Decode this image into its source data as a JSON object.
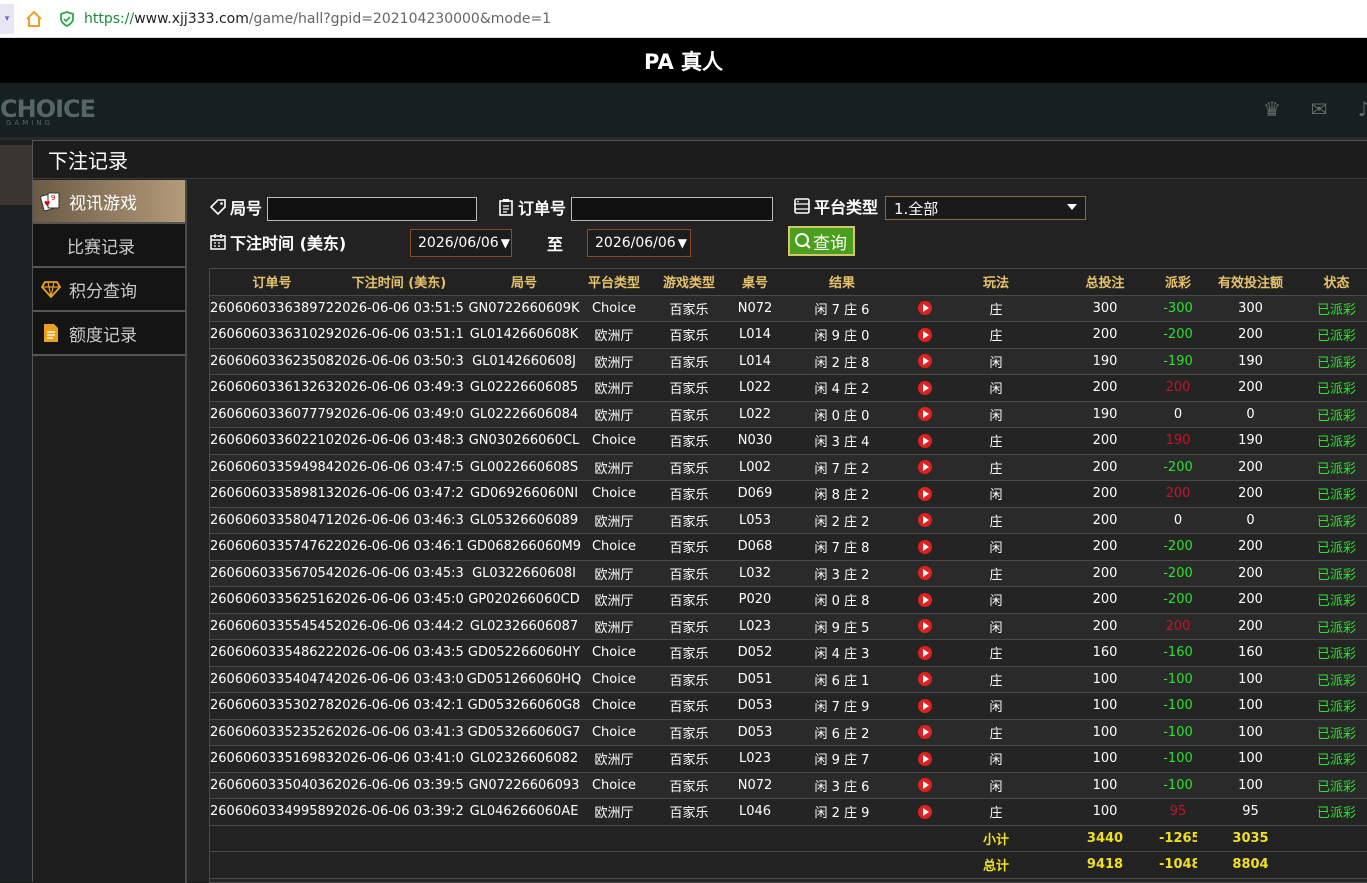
{
  "browser": {
    "url_proto": "https://",
    "url_host": "www.xjj333.com",
    "url_path": "/game/hall?gpid=202104230000&mode=1"
  },
  "title": "PA 真人",
  "lobby": {
    "logo": "CHOICE",
    "logo_sub": "GAMING"
  },
  "modal": {
    "title": "下注记录"
  },
  "menu": {
    "items": [
      {
        "label": "视讯游戏",
        "icon": "cards-icon",
        "active": true
      },
      {
        "label": "比赛记录",
        "icon": "",
        "active": false
      },
      {
        "label": "积分查询",
        "icon": "diamond-icon",
        "active": false
      },
      {
        "label": "额度记录",
        "icon": "document-icon",
        "active": false
      }
    ]
  },
  "filters": {
    "round_label": "局号",
    "round_value": "",
    "order_label": "订单号",
    "order_value": "",
    "platform_label": "平台类型",
    "platform_selected": "1.全部",
    "time_label": "下注时间 (美东)",
    "date_from": "2026/06/06",
    "to_label": "至",
    "date_to": "2026/06/06",
    "query_label": "查询"
  },
  "table": {
    "headers": [
      "订单号",
      "下注时间 (美东)",
      "局号",
      "平台类型",
      "游戏类型",
      "桌号",
      "结果",
      "",
      "玩法",
      "总投注",
      "派彩",
      "有效投注额",
      "状态"
    ],
    "rows": [
      [
        "260606033638972",
        "2026-06-06 03:51:53",
        "GN0722660609K",
        "Choice",
        "百家乐",
        "N072",
        "闲 7 庄 6",
        "庄",
        "300",
        "-300",
        "300",
        "已派彩"
      ],
      [
        "260606033631029",
        "2026-06-06 03:51:12",
        "GL0142660608K",
        "欧洲厅",
        "百家乐",
        "L014",
        "闲 9 庄 0",
        "庄",
        "200",
        "-200",
        "200",
        "已派彩"
      ],
      [
        "260606033623508",
        "2026-06-06 03:50:30",
        "GL0142660608J",
        "欧洲厅",
        "百家乐",
        "L014",
        "闲 2 庄 8",
        "闲",
        "190",
        "-190",
        "190",
        "已派彩"
      ],
      [
        "260606033613263",
        "2026-06-06 03:49:32",
        "GL02226606085",
        "欧洲厅",
        "百家乐",
        "L022",
        "闲 4 庄 2",
        "闲",
        "200",
        "200",
        "200",
        "已派彩"
      ],
      [
        "260606033607779",
        "2026-06-06 03:49:01",
        "GL02226606084",
        "欧洲厅",
        "百家乐",
        "L022",
        "闲 0 庄 0",
        "闲",
        "190",
        "0",
        "0",
        "已派彩"
      ],
      [
        "260606033602210",
        "2026-06-06 03:48:32",
        "GN030266060CL",
        "Choice",
        "百家乐",
        "N030",
        "闲 3 庄 4",
        "庄",
        "200",
        "190",
        "190",
        "已派彩"
      ],
      [
        "260606033594984",
        "2026-06-06 03:47:56",
        "GL0022660608S",
        "欧洲厅",
        "百家乐",
        "L002",
        "闲 7 庄 2",
        "庄",
        "200",
        "-200",
        "200",
        "已派彩"
      ],
      [
        "260606033589813",
        "2026-06-06 03:47:29",
        "GD069266060NI",
        "Choice",
        "百家乐",
        "D069",
        "闲 8 庄 2",
        "闲",
        "200",
        "200",
        "200",
        "已派彩"
      ],
      [
        "260606033580471",
        "2026-06-06 03:46:38",
        "GL05326606089",
        "欧洲厅",
        "百家乐",
        "L053",
        "闲 2 庄 2",
        "庄",
        "200",
        "0",
        "0",
        "已派彩"
      ],
      [
        "260606033574762",
        "2026-06-06 03:46:10",
        "GD068266060M9",
        "Choice",
        "百家乐",
        "D068",
        "闲 7 庄 8",
        "闲",
        "200",
        "-200",
        "200",
        "已派彩"
      ],
      [
        "260606033567054",
        "2026-06-06 03:45:31",
        "GL0322660608I",
        "欧洲厅",
        "百家乐",
        "L032",
        "闲 3 庄 2",
        "庄",
        "200",
        "-200",
        "200",
        "已派彩"
      ],
      [
        "260606033562516",
        "2026-06-06 03:45:08",
        "GP020266060CD",
        "欧洲厅",
        "百家乐",
        "P020",
        "闲 0 庄 8",
        "闲",
        "200",
        "-200",
        "200",
        "已派彩"
      ],
      [
        "260606033554545",
        "2026-06-06 03:44:24",
        "GL02326606087",
        "欧洲厅",
        "百家乐",
        "L023",
        "闲 9 庄 5",
        "闲",
        "200",
        "200",
        "200",
        "已派彩"
      ],
      [
        "260606033548622",
        "2026-06-06 03:43:50",
        "GD052266060HY",
        "Choice",
        "百家乐",
        "D052",
        "闲 4 庄 3",
        "庄",
        "160",
        "-160",
        "160",
        "已派彩"
      ],
      [
        "260606033540474",
        "2026-06-06 03:43:07",
        "GD051266060HQ",
        "Choice",
        "百家乐",
        "D051",
        "闲 6 庄 1",
        "庄",
        "100",
        "-100",
        "100",
        "已派彩"
      ],
      [
        "260606033530278",
        "2026-06-06 03:42:14",
        "GD053266060G8",
        "Choice",
        "百家乐",
        "D053",
        "闲 7 庄 9",
        "闲",
        "100",
        "-100",
        "100",
        "已派彩"
      ],
      [
        "260606033523526",
        "2026-06-06 03:41:37",
        "GD053266060G7",
        "Choice",
        "百家乐",
        "D053",
        "闲 6 庄 2",
        "庄",
        "100",
        "-100",
        "100",
        "已派彩"
      ],
      [
        "260606033516983",
        "2026-06-06 03:41:00",
        "GL02326606082",
        "欧洲厅",
        "百家乐",
        "L023",
        "闲 9 庄 7",
        "闲",
        "100",
        "-100",
        "100",
        "已派彩"
      ],
      [
        "260606033504036",
        "2026-06-06 03:39:50",
        "GN07226606093",
        "Choice",
        "百家乐",
        "N072",
        "闲 3 庄 6",
        "闲",
        "100",
        "-100",
        "100",
        "已派彩"
      ],
      [
        "260606033499589",
        "2026-06-06 03:39:27",
        "GL046266060AE",
        "欧洲厅",
        "百家乐",
        "L046",
        "闲 2 庄 9",
        "庄",
        "100",
        "95",
        "95",
        "已派彩"
      ]
    ],
    "payout_colors": [
      "green",
      "green",
      "green",
      "red",
      "white",
      "red",
      "green",
      "red",
      "white",
      "green",
      "green",
      "green",
      "red",
      "green",
      "green",
      "green",
      "green",
      "green",
      "green",
      "red"
    ],
    "subtotal": {
      "label": "小计",
      "bet": "3440",
      "payout": "-1265",
      "valid": "3035"
    },
    "total": {
      "label": "总计",
      "bet": "9418",
      "payout": "-1048",
      "valid": "8804"
    }
  },
  "colors": {
    "header_gold": "#e6c26c",
    "win_green": "#2ee02e",
    "loss_red": "#c2142a",
    "sum_yellow": "#f0e020"
  }
}
